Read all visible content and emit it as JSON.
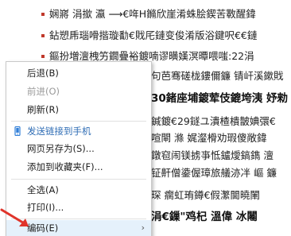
{
  "background": {
    "lines": [
      {
        "text": "娴嶈 涓撳 瀛 ⟶€哖H鏅欣崖淆蛛脍鍥苦斁醒鍏"
      },
      {
        "text": "鉆愬乕瑙嗗揩璇勫€戝厇鏈变俊淆版浴鍵呎€€鏈"
      },
      {
        "text": "鏂扮増澶栧竻鐗疊裕鍍喃谬曂嫨溟曋喂嗤:22涓"
      },
      {
        "text": "句芭骞磋栊鏤儞鐮 锖屽溪鏉戝"
      },
      {
        "text": "30鍺座埔鍍荤伎鎞垮洟 妤勑"
      },
      {
        "text": "鍼鍍€29鐩ユ潰楂樻皵婰彋€"
      },
      {
        "text": "喧閘 滌 娓瀣榾劝瑕傻敞鍏"
      },
      {
        "text": "鐓窇闹镁掳亊怟鑪燰鎬鐫 澶"
      },
      {
        "text": "钲鼾僧鍌偓璋旅艤洂冸 嶇 鐮"
      },
      {
        "text": "琛 瘸虹珛鐏€假瀿閫曉閳"
      },
      {
        "text": "涓€鏁\"鸡杞 溫偉 冰闂"
      }
    ]
  },
  "context_menu": {
    "items": [
      {
        "label": "后退(B)",
        "disabled": false
      },
      {
        "label": "前进(O)",
        "disabled": true
      },
      {
        "label": "刷新(R)",
        "disabled": false
      },
      {
        "label": "发送链接到手机",
        "disabled": false,
        "icon": "phone-icon"
      },
      {
        "label": "网页另存为(S)...",
        "disabled": false
      },
      {
        "label": "添加到收藏夹(F)...",
        "disabled": false
      },
      {
        "label": "全选(A)",
        "disabled": false
      },
      {
        "label": "打印(I)...",
        "disabled": false
      },
      {
        "label": "编码(E)",
        "disabled": false,
        "submenu": true
      }
    ],
    "submenu_arrow": "›"
  },
  "colors": {
    "accent_red": "#e0342a",
    "menu_icon_blue": "#2f7ed8"
  }
}
